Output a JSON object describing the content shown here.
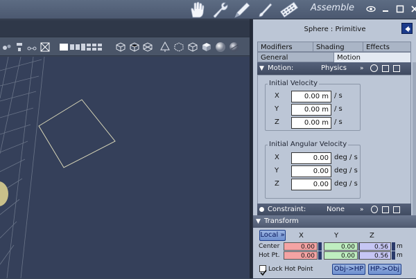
{
  "topbar": {
    "room_label": "Assemble",
    "tools": [
      "hand-icon",
      "wrench-icon",
      "pen-icon",
      "brush-icon",
      "film-icon"
    ]
  },
  "panel": {
    "object_title": "Sphere : Primitive",
    "tabs_row1": [
      "Modifiers",
      "Shading",
      "Effects"
    ],
    "tabs_row2": [
      "General",
      "Motion"
    ],
    "motion": {
      "label": "Motion:",
      "mode": "Physics",
      "initial_velocity": {
        "legend": "Initial Velocity",
        "rows": [
          {
            "axis": "X",
            "value": "0.00 m",
            "unit": "/ s"
          },
          {
            "axis": "Y",
            "value": "0.00 m",
            "unit": "/ s"
          },
          {
            "axis": "Z",
            "value": "0.00 m",
            "unit": "/ s"
          }
        ]
      },
      "initial_angular_velocity": {
        "legend": "Initial Angular Velocity",
        "rows": [
          {
            "axis": "X",
            "value": "0.00",
            "unit": "deg / s"
          },
          {
            "axis": "Y",
            "value": "0.00",
            "unit": "deg / s"
          },
          {
            "axis": "Z",
            "value": "0.00",
            "unit": "deg / s"
          }
        ]
      }
    },
    "constraint": {
      "label": "Constraint:",
      "value": "None"
    },
    "transform": {
      "label": "Transform",
      "space": "Local",
      "cols": [
        "X",
        "Y",
        "Z"
      ],
      "center": {
        "label": "Center",
        "x": "0.00",
        "y": "0.00",
        "z": "0.56",
        "unit": "m"
      },
      "hot_point": {
        "label": "Hot Pt.",
        "x": "0.00",
        "y": "0.00",
        "z": "0.56",
        "unit": "m"
      },
      "lock_label": "Lock Hot Point",
      "btn_obj_hp": "Obj->HP",
      "btn_hp_obj": "HP->Obj"
    }
  },
  "colors": {
    "x_field": "#f4a3a3",
    "y_field": "#bfeec0",
    "z_field": "#c6c6f4",
    "accent": "#1b3a8a"
  }
}
